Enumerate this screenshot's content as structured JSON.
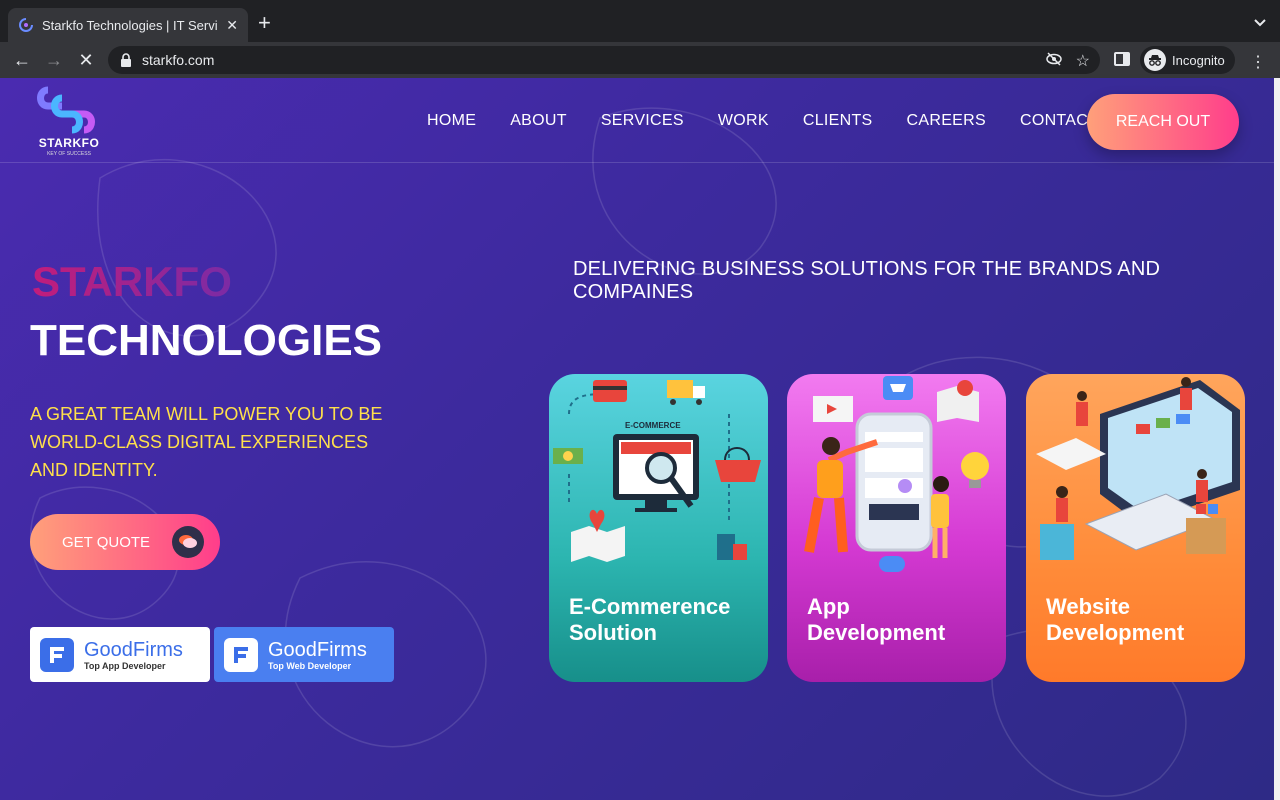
{
  "browser": {
    "tab_title": "Starkfo Technologies | IT Servi",
    "new_tab_icon": "plus-icon",
    "url": "starkfo.com",
    "profile_label": "Incognito"
  },
  "site": {
    "logo_name": "STARKFO",
    "logo_tagline": "KEY OF SUCCESS",
    "nav": [
      "HOME",
      "ABOUT",
      "SERVICES",
      "WORK",
      "CLIENTS",
      "CAREERS",
      "CONTACT"
    ],
    "reach_out": "REACH OUT",
    "hero_title_1": "STARKFO",
    "hero_title_2": "TECHNOLOGIES",
    "hero_subtitle": "A GREAT TEAM WILL POWER YOU TO BE WORLD-CLASS DIGITAL EXPERIENCES AND IDENTITY.",
    "get_quote": "GET QUOTE",
    "tagline": "DELIVERING BUSINESS SOLUTIONS FOR THE BRANDS AND COMPAINES",
    "badges": [
      {
        "name": "GoodFirms",
        "sub": "Top App Developer"
      },
      {
        "name": "GoodFirms",
        "sub": "Top Web Developer"
      }
    ],
    "cards": [
      {
        "line1": "E-Commerence",
        "line2": "Solution",
        "illustration_label": "E-COMMERCE"
      },
      {
        "line1": "App",
        "line2": "Development"
      },
      {
        "line1": "Website",
        "line2": "Development"
      }
    ]
  },
  "colors": {
    "accent_gradient_start": "#ffa07a",
    "accent_gradient_end": "#ff3d8b",
    "hero_subtitle": "#ffe04b",
    "card_ecommerce": "#3fc5c7",
    "card_app": "#d53ad3",
    "card_web": "#ff8c3a"
  }
}
